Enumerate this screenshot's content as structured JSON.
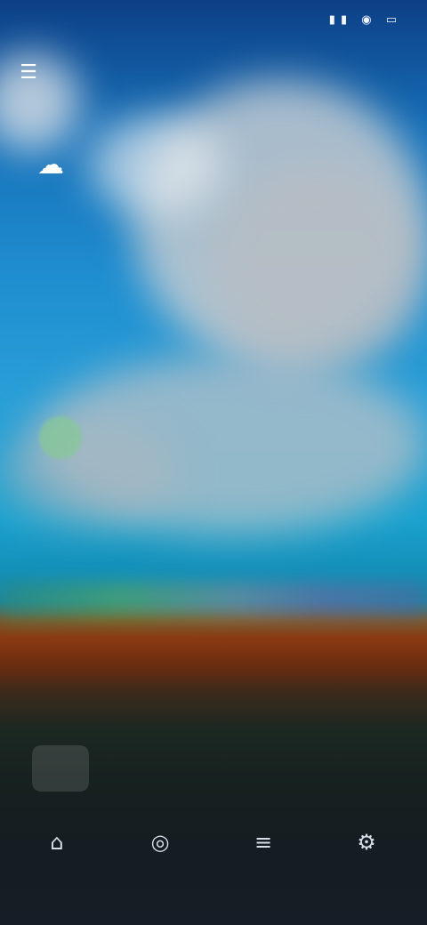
{
  "status_bar": {
    "time": "",
    "icons": "▮▮ ◉ ▭"
  },
  "header": {
    "title": ""
  },
  "hero": {
    "current_temp": "",
    "feels_like": "",
    "hi_lo": "",
    "condition": ""
  },
  "today": {
    "section_title": "",
    "uv_value": "",
    "uv_desc": "",
    "wind_label": ""
  },
  "sun": {
    "sunrise": "",
    "sunset": "",
    "horizon_label": ""
  },
  "panel": {
    "title": "",
    "aqi_value": "",
    "aqi_unit": ""
  },
  "nav": {
    "items": [
      {
        "label": "",
        "icon": "home-icon"
      },
      {
        "label": "",
        "icon": "radar-icon"
      },
      {
        "label": "",
        "icon": "list-icon"
      },
      {
        "label": "",
        "icon": "settings-icon"
      }
    ]
  },
  "colors": {
    "sky_top": "#0d3f86",
    "sky_mid": "#1f8ed0",
    "horizon": "#8a3a12",
    "ground": "#16211f"
  }
}
